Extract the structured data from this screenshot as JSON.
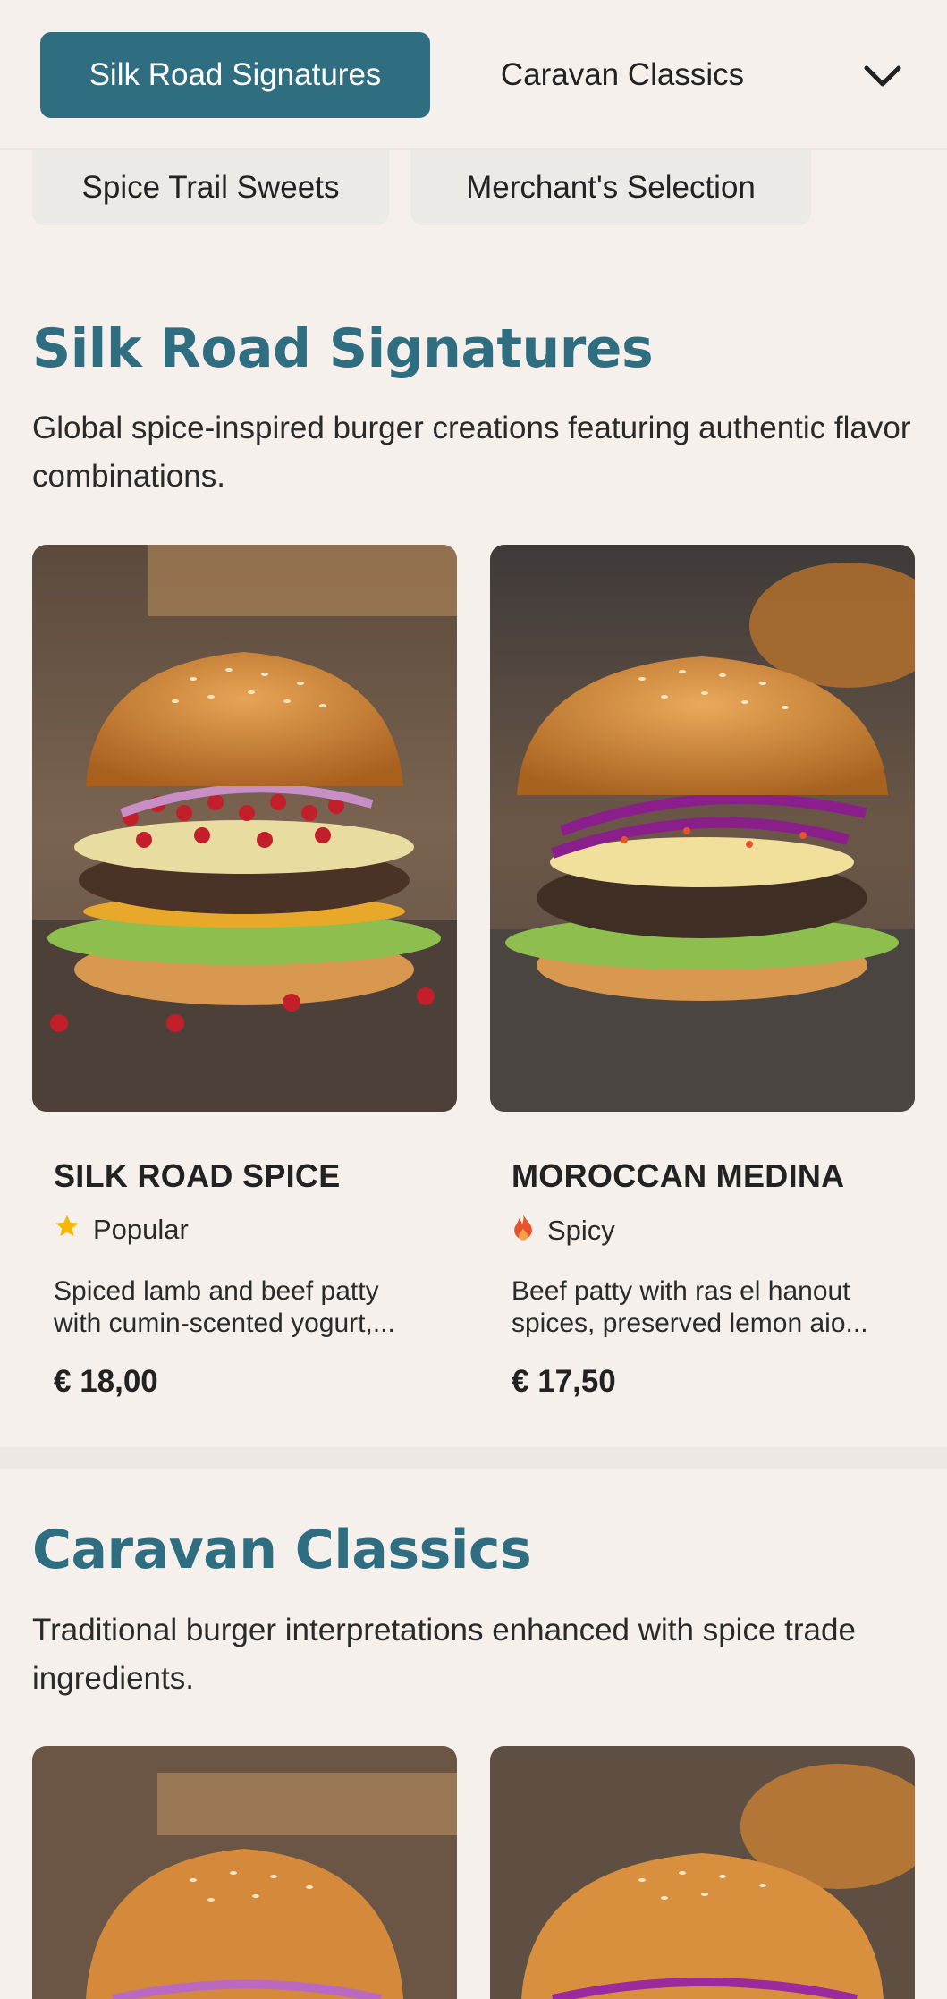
{
  "nav": {
    "tabs": [
      {
        "label": "Silk Road Signatures",
        "active": true
      },
      {
        "label": "Caravan Classics",
        "active": false
      }
    ],
    "chips": [
      {
        "label": "Spice Trail Sweets"
      },
      {
        "label": "Merchant's Selection"
      }
    ],
    "expand_icon": "chevron-down-icon"
  },
  "sections": [
    {
      "title": "Silk Road Signatures",
      "description": "Global spice-inspired burger creations featuring authentic flavor combinations.",
      "items": [
        {
          "name": "SILK ROAD SPICE",
          "badge": {
            "icon": "star-icon",
            "label": "Popular",
            "color": "#f5b800"
          },
          "description_line1": "Spiced lamb and beef patty",
          "description_line2": "with cumin-scented yogurt,...",
          "price": "€ 18,00"
        },
        {
          "name": "MOROCCAN MEDINA",
          "badge": {
            "icon": "flame-icon",
            "label": "Spicy",
            "color": "#e8532b"
          },
          "description_line1": "Beef patty with ras el hanout",
          "description_line2": "spices, preserved lemon aio...",
          "price": "€ 17,50"
        }
      ]
    },
    {
      "title": "Caravan Classics",
      "description": "Traditional burger interpretations enhanced with spice trade ingredients."
    }
  ],
  "colors": {
    "accent": "#2e6e80",
    "background": "#f5f0ec",
    "chip_background": "#eceae6"
  }
}
